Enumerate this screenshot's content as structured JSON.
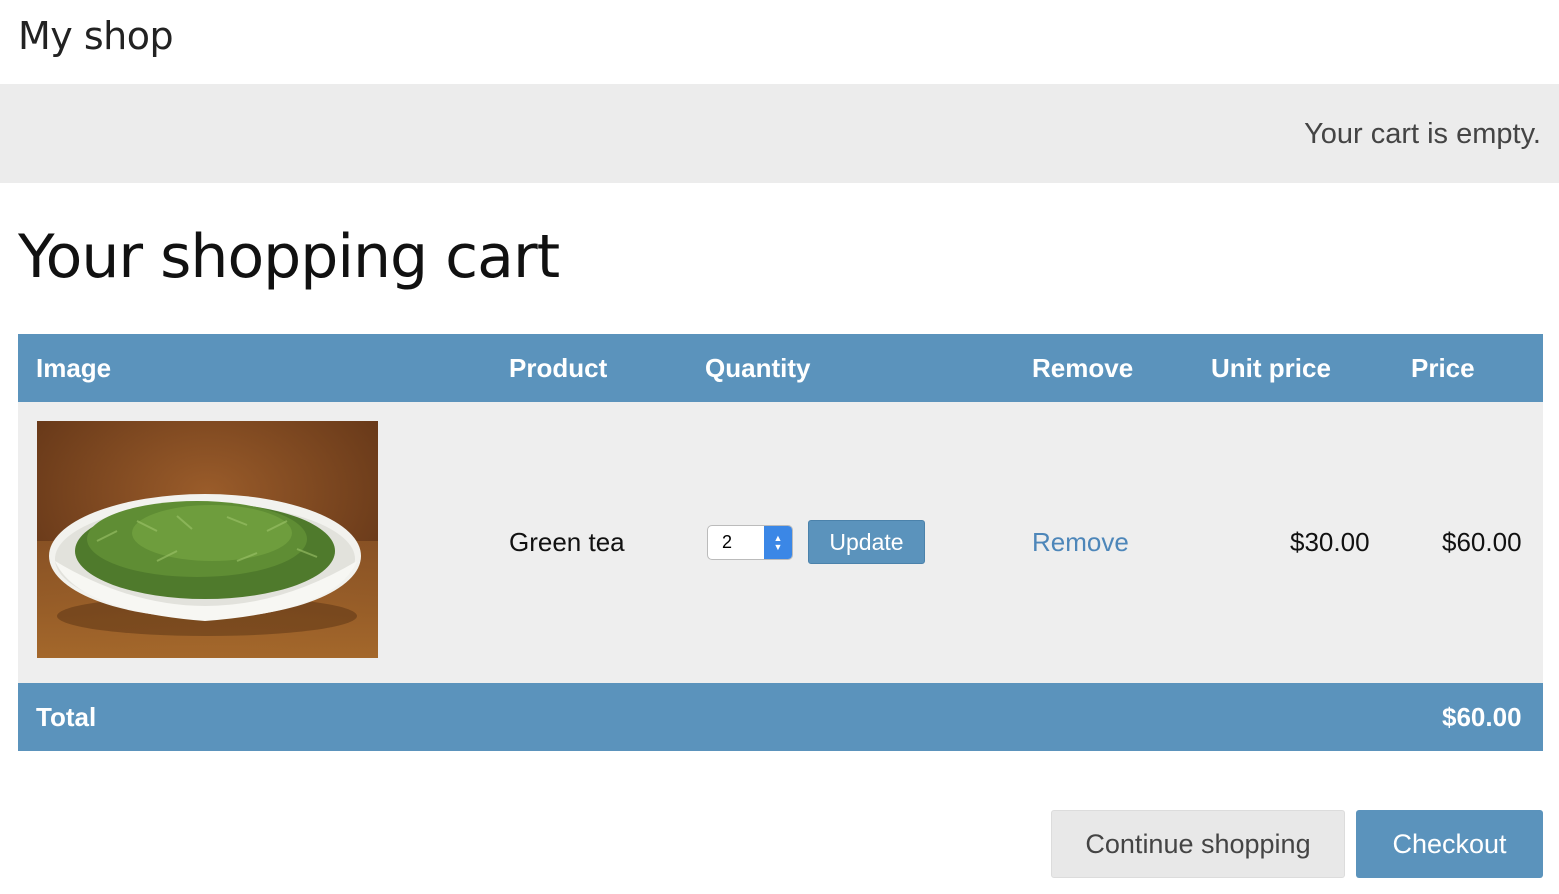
{
  "header": {
    "site_title": "My shop"
  },
  "subheader": {
    "cart_status": "Your cart is empty."
  },
  "page": {
    "heading": "Your shopping cart"
  },
  "table": {
    "columns": {
      "image": "Image",
      "product": "Product",
      "quantity": "Quantity",
      "remove": "Remove",
      "unit_price": "Unit price",
      "price": "Price"
    },
    "items": [
      {
        "image_icon": "green-tea-bowl-photo",
        "product": "Green tea",
        "quantity": "2",
        "update_label": "Update",
        "remove_label": "Remove",
        "unit_price": "$30.00",
        "price": "$60.00"
      }
    ],
    "footer": {
      "total_label": "Total",
      "total_value": "$60.00"
    }
  },
  "actions": {
    "continue_label": "Continue shopping",
    "checkout_label": "Checkout"
  },
  "colors": {
    "accent": "#5b93bc",
    "link": "#4d86b9",
    "row_bg": "#eeeeee",
    "subheader_bg": "#ececec"
  }
}
